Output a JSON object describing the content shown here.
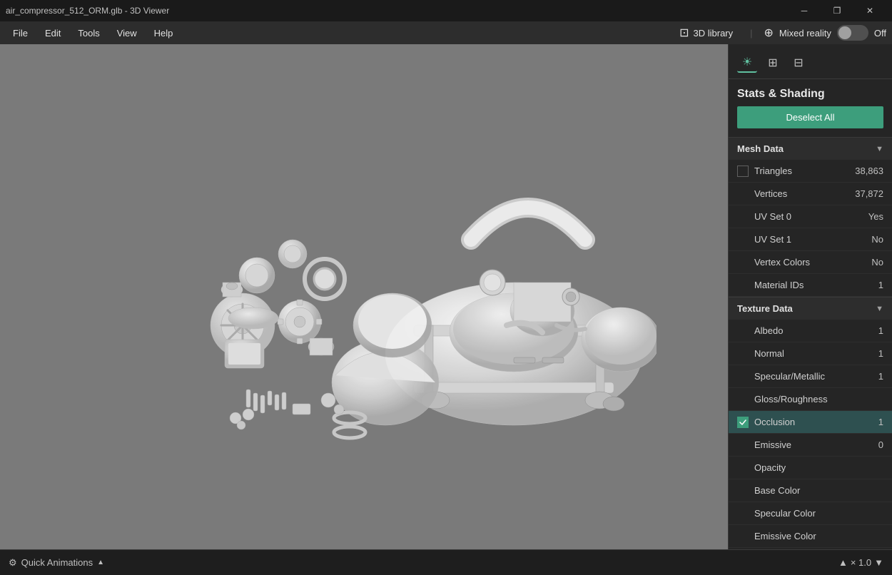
{
  "titleBar": {
    "title": "air_compressor_512_ORM.glb - 3D Viewer",
    "controls": {
      "minimize": "─",
      "restore": "❐",
      "close": "✕"
    }
  },
  "menuBar": {
    "items": [
      "File",
      "Edit",
      "Tools",
      "View",
      "Help"
    ],
    "library": "3D library",
    "mixedReality": "Mixed reality",
    "mixedRealityState": "Off",
    "separator": "|"
  },
  "panelToolbar": {
    "icons": [
      {
        "name": "sun-icon",
        "symbol": "☀",
        "active": true
      },
      {
        "name": "grid-icon",
        "symbol": "⊞",
        "active": false
      },
      {
        "name": "grid2-icon",
        "symbol": "⊟",
        "active": false
      }
    ]
  },
  "panel": {
    "title": "Stats & Shading",
    "deselectAll": "Deselect All",
    "meshData": {
      "header": "Mesh Data",
      "rows": [
        {
          "label": "Triangles",
          "value": "38,863",
          "hasCheckbox": true,
          "checked": false
        },
        {
          "label": "Vertices",
          "value": "37,872",
          "hasCheckbox": false
        },
        {
          "label": "UV Set 0",
          "value": "Yes",
          "hasCheckbox": false
        },
        {
          "label": "UV Set 1",
          "value": "No",
          "hasCheckbox": false
        },
        {
          "label": "Vertex Colors",
          "value": "No",
          "hasCheckbox": false
        },
        {
          "label": "Material IDs",
          "value": "1",
          "hasCheckbox": false
        }
      ]
    },
    "textureData": {
      "header": "Texture Data",
      "rows": [
        {
          "label": "Albedo",
          "value": "1",
          "hasCheckbox": false
        },
        {
          "label": "Normal",
          "value": "1",
          "hasCheckbox": false
        },
        {
          "label": "Specular/Metallic",
          "value": "1",
          "hasCheckbox": false
        },
        {
          "label": "Gloss/Roughness",
          "value": "",
          "hasCheckbox": false
        },
        {
          "label": "Occlusion",
          "value": "1",
          "hasCheckbox": true,
          "checked": true,
          "selected": true
        },
        {
          "label": "Emissive",
          "value": "0",
          "hasCheckbox": false
        },
        {
          "label": "Opacity",
          "value": "",
          "hasCheckbox": false
        },
        {
          "label": "Base Color",
          "value": "",
          "hasCheckbox": false
        },
        {
          "label": "Specular Color",
          "value": "",
          "hasCheckbox": false
        },
        {
          "label": "Emissive Color",
          "value": "",
          "hasCheckbox": false
        }
      ]
    }
  },
  "bottomBar": {
    "quickAnimations": "Quick Animations",
    "zoom": "× 1.0"
  }
}
